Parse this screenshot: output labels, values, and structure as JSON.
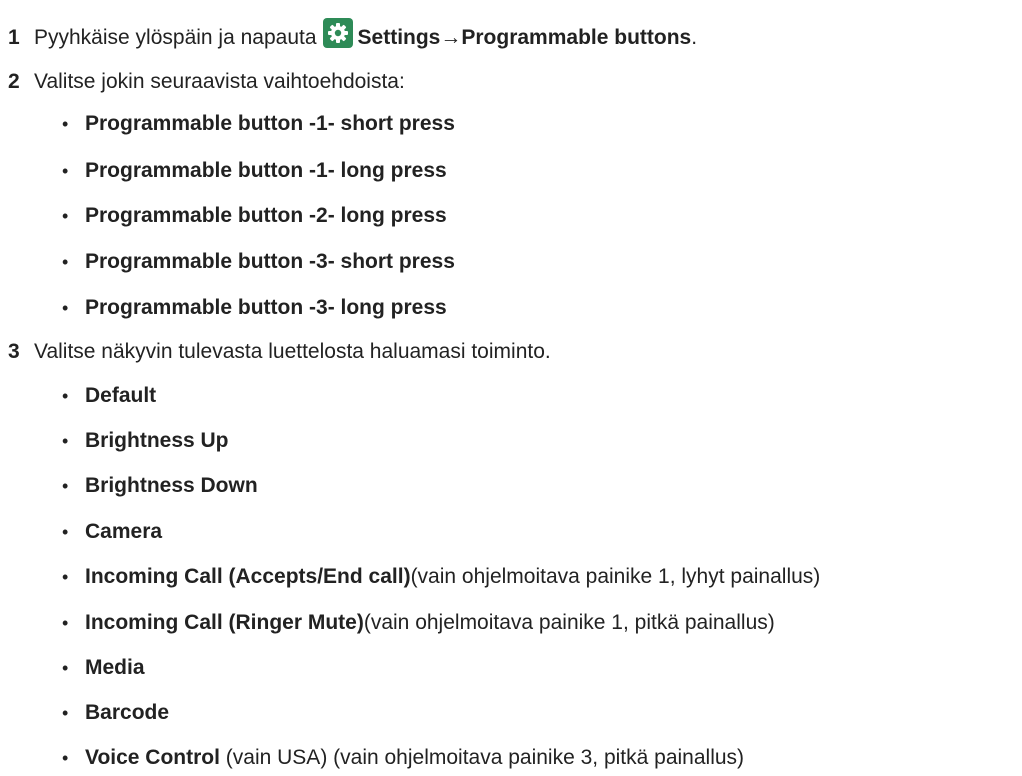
{
  "steps": [
    {
      "number": "1",
      "text_before": "Pyyhkäise ylöspäin ja napauta",
      "icon": "settings-gear-icon",
      "path_bold": "Settings→Programmable buttons",
      "text_after": "."
    },
    {
      "number": "2",
      "text": "Valitse jokin seuraavista vaihtoehdoista:",
      "items": [
        "Programmable button -1- short press",
        "Programmable button -1- long press",
        "Programmable button -2- long press",
        "Programmable button -3- short press",
        "Programmable button -3- long press"
      ]
    },
    {
      "number": "3",
      "text": "Valitse näkyvin tulevasta luettelosta haluamasi toiminto.",
      "items": [
        {
          "label": "Default",
          "note": ""
        },
        {
          "label": "Brightness Up",
          "note": ""
        },
        {
          "label": "Brightness Down",
          "note": ""
        },
        {
          "label": "Camera",
          "note": ""
        },
        {
          "label": "Incoming Call (Accepts/End call)",
          "note": "(vain ohjelmoitava painike 1, lyhyt painallus)"
        },
        {
          "label": "Incoming Call (Ringer Mute)",
          "note": "(vain ohjelmoitava painike 1, pitkä painallus)"
        },
        {
          "label": "Media",
          "note": ""
        },
        {
          "label": "Barcode",
          "note": ""
        },
        {
          "label": "Voice Control",
          "note": " (vain USA) (vain ohjelmoitava painike 3, pitkä painallus)"
        }
      ]
    }
  ],
  "bullet_char": "•",
  "colors": {
    "text": "#222222",
    "icon_bg": "#2e8b57",
    "icon_fg": "#ffffff"
  }
}
